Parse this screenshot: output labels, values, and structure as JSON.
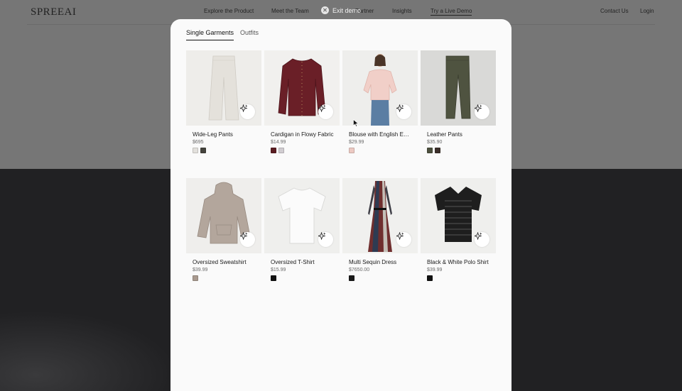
{
  "site": {
    "logo": "SPREEAI",
    "nav": [
      "Explore the Product",
      "Meet the Team",
      "Partner",
      "Insights",
      "Try a Live Demo"
    ],
    "right_nav": [
      "Contact Us",
      "Login"
    ]
  },
  "exit_demo": {
    "label": "Exit demo"
  },
  "tabs": [
    {
      "label": "Single Garments",
      "active": true
    },
    {
      "label": "Outfits",
      "active": false
    }
  ],
  "products": [
    {
      "name": "Wide-Leg Pants",
      "price": "$695",
      "icon": "pants-icon",
      "swatches": [
        "#e2e0dc",
        "#45433d"
      ]
    },
    {
      "name": "Cardigan in Flowy Fabric",
      "price": "$14.99",
      "icon": "cardigan-icon",
      "swatches": [
        "#5a1d22",
        "#d0ccd0"
      ]
    },
    {
      "name": "Blouse with English E…",
      "price": "$29.99",
      "icon": "blouse-model-icon",
      "swatches": [
        "#ecc9c2"
      ]
    },
    {
      "name": "Leather Pants",
      "price": "$35.90",
      "icon": "leather-pants-icon",
      "swatches": [
        "#4c4f3d",
        "#3b2f2a"
      ]
    },
    {
      "name": "Oversized Sweatshirt",
      "price": "$39.99",
      "icon": "hoodie-icon",
      "swatches": [
        "#a99a8f"
      ]
    },
    {
      "name": "Oversized T-Shirt",
      "price": "$15.99",
      "icon": "tshirt-icon",
      "swatches": [
        "#111111"
      ]
    },
    {
      "name": "Multi Sequin Dress",
      "price": "$7650.00",
      "icon": "dress-icon",
      "swatches": [
        "#1a1a1a"
      ]
    },
    {
      "name": "Black & White Polo Shirt",
      "price": "$39.99",
      "icon": "polo-icon",
      "swatches": [
        "#111111"
      ]
    }
  ]
}
